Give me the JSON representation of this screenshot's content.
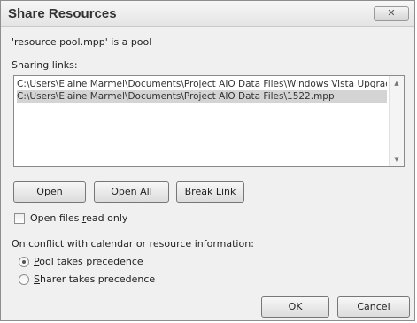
{
  "dialog": {
    "title": "Share Resources",
    "close_symbol": "✕",
    "pool_info": "'resource pool.mpp' is a pool",
    "links_label": "Sharing links:",
    "links": [
      "C:\\Users\\Elaine Marmel\\Documents\\Project AIO Data Files\\Windows Vista Upgrade",
      "C:\\Users\\Elaine Marmel\\Documents\\Project AIO Data Files\\1522.mpp"
    ],
    "selected_link_index": 1,
    "scroll_up_symbol": "▲",
    "scroll_down_symbol": "▼",
    "buttons": {
      "open": {
        "accel": "O",
        "rest": "pen"
      },
      "open_all": {
        "before": "Open ",
        "accel": "A",
        "rest": "ll"
      },
      "break_link": {
        "accel": "B",
        "rest": "reak Link"
      },
      "ok": "OK",
      "cancel": "Cancel"
    },
    "read_only": {
      "before": "Open files ",
      "accel": "r",
      "rest": "ead only",
      "checked": false
    },
    "conflict_label": "On conflict with calendar or resource information:",
    "options": [
      {
        "accel": "P",
        "rest": "ool takes precedence",
        "checked": true
      },
      {
        "accel": "S",
        "rest": "harer takes precedence",
        "checked": false
      }
    ]
  }
}
